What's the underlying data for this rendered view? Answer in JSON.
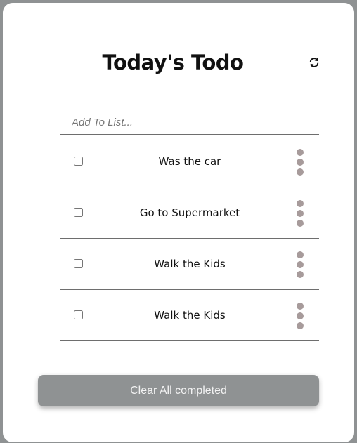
{
  "header": {
    "title": "Today's Todo",
    "refresh_icon": "refresh-icon"
  },
  "input": {
    "placeholder": "Add To List...",
    "value": ""
  },
  "todos": [
    {
      "label": "Was the car",
      "checked": false
    },
    {
      "label": "Go to Supermarket",
      "checked": false
    },
    {
      "label": "Walk the Kids",
      "checked": false
    },
    {
      "label": "Walk the Kids",
      "checked": false
    }
  ],
  "menu_icon": "more-vertical-icon",
  "footer": {
    "clear_label": "Clear All completed"
  },
  "colors": {
    "background": "#8f9293",
    "card": "#ffffff",
    "button": "#8f9293",
    "dots": "#a79b9b"
  }
}
